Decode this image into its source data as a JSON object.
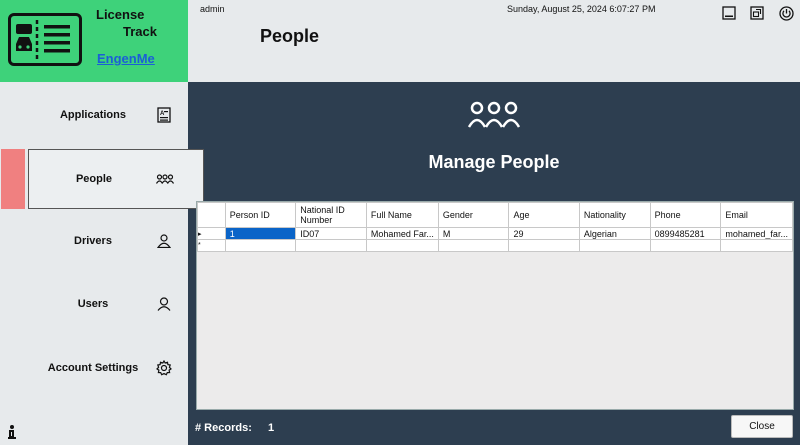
{
  "app": {
    "name_line1": "License",
    "name_line2": "Track",
    "link": "EngenMe"
  },
  "header": {
    "user": "admin",
    "datetime": "Sunday, August 25, 2024 6:07:27 PM",
    "page_title": "People"
  },
  "sidebar": {
    "items": [
      {
        "label": "Applications",
        "icon": "application-form-icon",
        "active": false
      },
      {
        "label": "People",
        "icon": "people-group-icon",
        "active": true
      },
      {
        "label": "Drivers",
        "icon": "driver-person-icon",
        "active": false
      },
      {
        "label": "Users",
        "icon": "user-icon",
        "active": false
      },
      {
        "label": "Account Settings",
        "icon": "gear-icon",
        "active": false
      }
    ]
  },
  "main": {
    "title": "Manage People",
    "columns": [
      "Person ID",
      "National ID Number",
      "Full Name",
      "Gender",
      "Age",
      "Nationality",
      "Phone",
      "Email"
    ],
    "rows": [
      [
        "1",
        "ID07",
        "Mohamed Far...",
        "M",
        "29",
        "Algerian",
        "0899485281",
        "mohamed_far..."
      ]
    ],
    "records_label": "# Records:",
    "records_count": "1",
    "close_label": "Close"
  },
  "colors": {
    "accent_green": "#3ed27a",
    "main_bg": "#2d3e50",
    "active_marker": "#f08080",
    "selection": "#0a64c8"
  }
}
